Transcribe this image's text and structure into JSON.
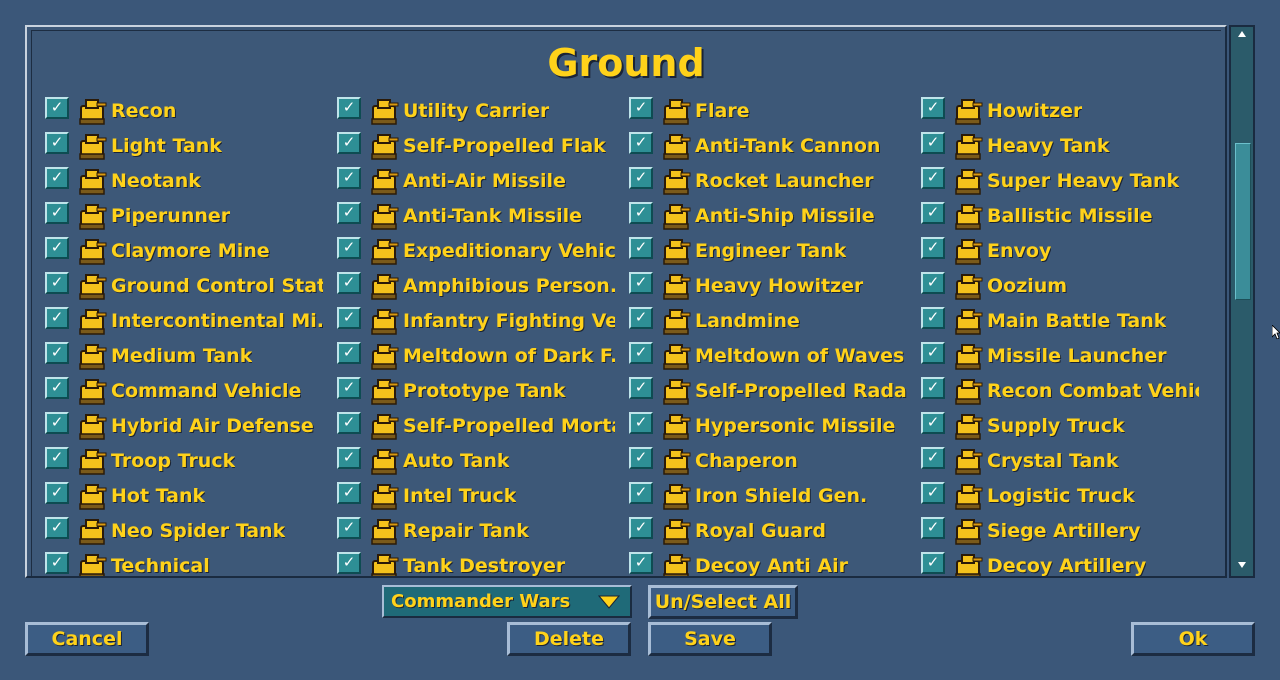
{
  "title": "Ground",
  "columns": [
    [
      {
        "label": "Recon",
        "checked": true
      },
      {
        "label": "Light Tank",
        "checked": true
      },
      {
        "label": "Neotank",
        "checked": true
      },
      {
        "label": "Piperunner",
        "checked": true
      },
      {
        "label": "Claymore Mine",
        "checked": true
      },
      {
        "label": "Ground Control Stat...",
        "checked": true
      },
      {
        "label": "Intercontinental Mi...",
        "checked": true
      },
      {
        "label": "Medium Tank",
        "checked": true
      },
      {
        "label": "Command Vehicle",
        "checked": true
      },
      {
        "label": "Hybrid Air Defense",
        "checked": true
      },
      {
        "label": "Troop Truck",
        "checked": true
      },
      {
        "label": "Hot Tank",
        "checked": true
      },
      {
        "label": "Neo Spider Tank",
        "checked": true
      },
      {
        "label": "Technical",
        "checked": true
      }
    ],
    [
      {
        "label": "Utility Carrier",
        "checked": true
      },
      {
        "label": "Self-Propelled Flak",
        "checked": true
      },
      {
        "label": "Anti-Air Missile",
        "checked": true
      },
      {
        "label": "Anti-Tank Missile",
        "checked": true
      },
      {
        "label": "Expeditionary Vehicle",
        "checked": true
      },
      {
        "label": "Amphibious Person...",
        "checked": true
      },
      {
        "label": "Infantry Fighting Ve...",
        "checked": true
      },
      {
        "label": "Meltdown of Dark F...",
        "checked": true
      },
      {
        "label": "Prototype Tank",
        "checked": true
      },
      {
        "label": "Self-Propelled Mortar",
        "checked": true
      },
      {
        "label": "Auto Tank",
        "checked": true
      },
      {
        "label": "Intel Truck",
        "checked": true
      },
      {
        "label": "Repair Tank",
        "checked": true
      },
      {
        "label": "Tank Destroyer",
        "checked": true
      }
    ],
    [
      {
        "label": "Flare",
        "checked": true
      },
      {
        "label": "Anti-Tank Cannon",
        "checked": true
      },
      {
        "label": "Rocket Launcher",
        "checked": true
      },
      {
        "label": "Anti-Ship Missile",
        "checked": true
      },
      {
        "label": "Engineer Tank",
        "checked": true
      },
      {
        "label": "Heavy Howitzer",
        "checked": true
      },
      {
        "label": "Landmine",
        "checked": true
      },
      {
        "label": "Meltdown of Waves",
        "checked": true
      },
      {
        "label": "Self-Propelled Radar",
        "checked": true
      },
      {
        "label": "Hypersonic Missile",
        "checked": true
      },
      {
        "label": "Chaperon",
        "checked": true
      },
      {
        "label": "Iron Shield Gen.",
        "checked": true
      },
      {
        "label": "Royal Guard",
        "checked": true
      },
      {
        "label": "Decoy Anti Air",
        "checked": true
      }
    ],
    [
      {
        "label": "Howitzer",
        "checked": true
      },
      {
        "label": "Heavy Tank",
        "checked": true
      },
      {
        "label": "Super Heavy Tank",
        "checked": true
      },
      {
        "label": "Ballistic Missile",
        "checked": true
      },
      {
        "label": "Envoy",
        "checked": true
      },
      {
        "label": "Oozium",
        "checked": true
      },
      {
        "label": "Main Battle Tank",
        "checked": true
      },
      {
        "label": "Missile Launcher",
        "checked": true
      },
      {
        "label": "Recon Combat Vehicle",
        "checked": true
      },
      {
        "label": "Supply Truck",
        "checked": true
      },
      {
        "label": "Crystal Tank",
        "checked": true
      },
      {
        "label": "Logistic Truck",
        "checked": true
      },
      {
        "label": "Siege Artillery",
        "checked": true
      },
      {
        "label": "Decoy Artillery",
        "checked": true
      }
    ]
  ],
  "checkmark": "✓",
  "dropdown": {
    "value": "Commander Wars"
  },
  "buttons": {
    "unselect_all": "Un/Select All",
    "cancel": "Cancel",
    "delete": "Delete",
    "save": "Save",
    "ok": "Ok"
  },
  "colors": {
    "background": "#3b5779",
    "text": "#ffd21a",
    "checkbox": "#2e8f95",
    "unit_body": "#f4c21c"
  },
  "scrollbar": {
    "up_icon": "triangle-up-icon",
    "down_icon": "triangle-down-icon"
  }
}
